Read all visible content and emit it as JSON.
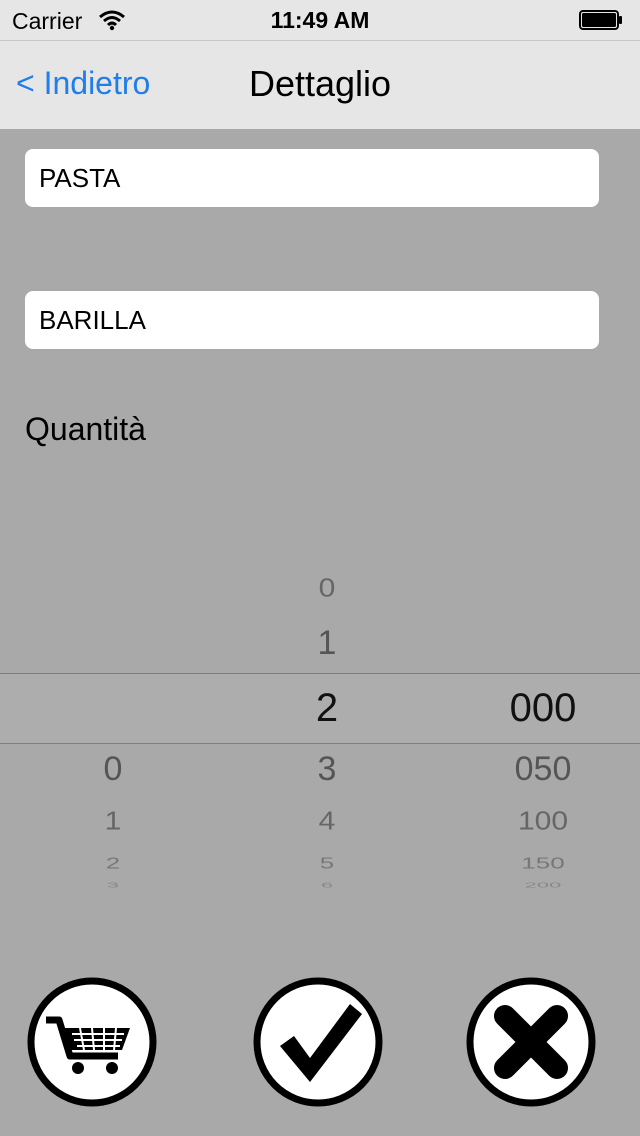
{
  "status_bar": {
    "carrier": "Carrier",
    "time": "11:49 AM"
  },
  "nav": {
    "back_label": "< Indietro",
    "title": "Dettaglio",
    "back_color": "#1f7ee9"
  },
  "form": {
    "product_value": "PASTA",
    "brand_value": "BARILLA",
    "quantity_label": "Quantità"
  },
  "picker": {
    "col1": {
      "selected": "",
      "above": [],
      "below": [
        "0",
        "1",
        "2",
        "3"
      ]
    },
    "col2": {
      "selected": "2",
      "above": [
        "0",
        "1"
      ],
      "below": [
        "3",
        "4",
        "5",
        "6"
      ]
    },
    "col3": {
      "selected": "000",
      "above": [],
      "below": [
        "050",
        "100",
        "150",
        "200"
      ]
    }
  },
  "actions": {
    "cart_icon": "shopping-cart-icon",
    "confirm_icon": "checkmark-icon",
    "cancel_icon": "cross-icon"
  }
}
